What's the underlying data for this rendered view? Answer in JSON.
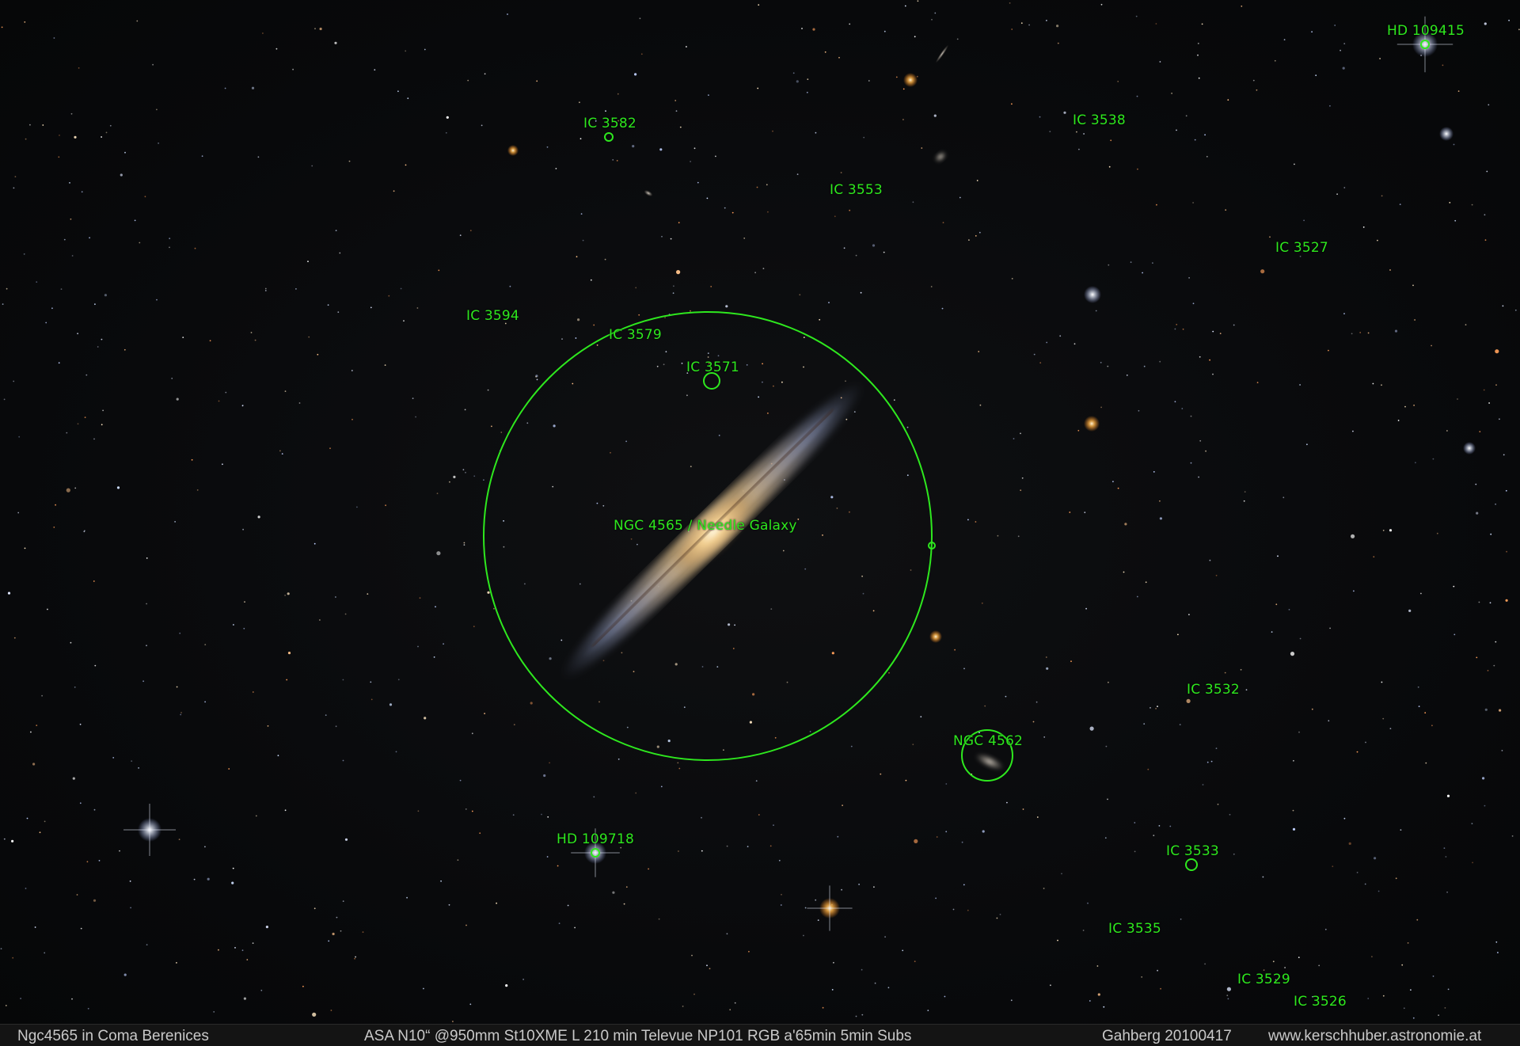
{
  "image": {
    "subject": "Ngc4565 in Coma Berenices",
    "accent_color": "#2ee81e",
    "background_color": "#07080a"
  },
  "labels": {
    "hd_109415": "HD 109415",
    "ic_3582": "IC 3582",
    "ic_3538": "IC 3538",
    "ic_3553": "IC 3553",
    "ic_3527": "IC 3527",
    "ic_3594": "IC 3594",
    "ic_3579": "IC 3579",
    "ic_3571": "IC 3571",
    "ngc_4565": "NGC 4565 / Needle Galaxy",
    "ic_3532": "IC 3532",
    "ngc_4562": "NGC 4562",
    "hd_109718": "HD 109718",
    "ic_3533": "IC 3533",
    "ic_3535": "IC 3535",
    "ic_3529": "IC 3529",
    "ic_3526": "IC 3526"
  },
  "caption": {
    "title": "Ngc4565 in Coma Berenices",
    "equipment": "ASA N10“ @950mm  St10XME L 210 min  Televue NP101 RGB a'65min 5min Subs",
    "location_date": "Gahberg 20100417",
    "website": "www.kerschhuber.astronomie.at"
  }
}
